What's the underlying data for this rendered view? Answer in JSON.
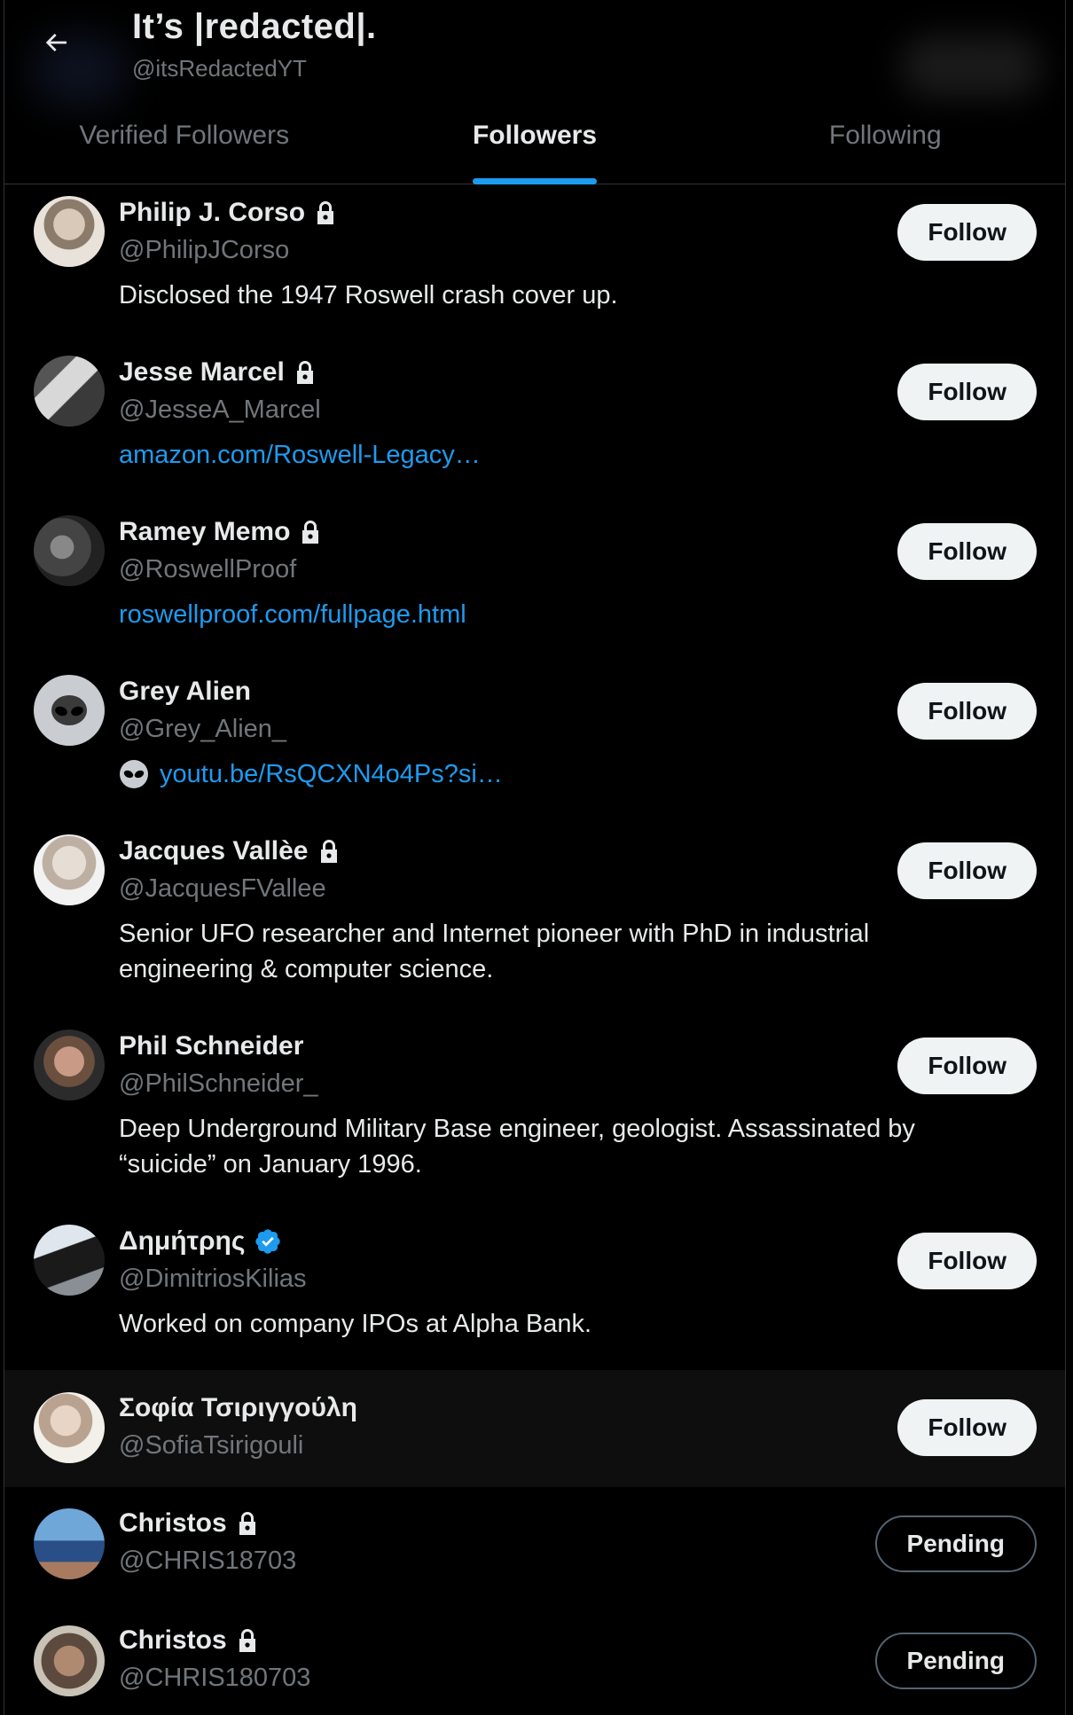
{
  "header": {
    "title": "It’s |redacted|.",
    "handle": "@itsRedactedYT"
  },
  "tabs": [
    {
      "label": "Verified Followers",
      "active": false
    },
    {
      "label": "Followers",
      "active": true
    },
    {
      "label": "Following",
      "active": false
    }
  ],
  "colors": {
    "accent": "#1d9bf0",
    "background": "#000000",
    "muted": "#71767b"
  },
  "users": [
    {
      "name": "Philip J. Corso",
      "handle": "@PhilipJCorso",
      "locked": true,
      "verified": false,
      "bio": "Disclosed the 1947 Roswell crash cover up.",
      "bio_is_link": false,
      "button": "Follow"
    },
    {
      "name": "Jesse Marcel",
      "handle": "@JesseA_Marcel",
      "locked": true,
      "verified": false,
      "bio": "amazon.com/Roswell-Legacy…",
      "bio_is_link": true,
      "button": "Follow"
    },
    {
      "name": "Ramey Memo",
      "handle": "@RoswellProof",
      "locked": true,
      "verified": false,
      "bio": "roswellproof.com/fullpage.html",
      "bio_is_link": true,
      "button": "Follow"
    },
    {
      "name": "Grey Alien",
      "handle": "@Grey_Alien_",
      "locked": false,
      "verified": false,
      "bio": "youtu.be/RsQCXN4o4Ps?si…",
      "bio_is_link": true,
      "bio_icon": "alien-emoji-icon",
      "button": "Follow"
    },
    {
      "name": "Jacques Vallèe",
      "handle": "@JacquesFVallee",
      "locked": true,
      "verified": false,
      "bio": "Senior UFO researcher and Internet pioneer with PhD in industrial engineering & computer science.",
      "bio_is_link": false,
      "button": "Follow"
    },
    {
      "name": "Phil Schneider",
      "handle": "@PhilSchneider_",
      "locked": false,
      "verified": false,
      "bio": "Deep Underground Military Base engineer, geologist. Assassinated by “suicide” on January 1996.",
      "bio_is_link": false,
      "button": "Follow"
    },
    {
      "name": "Δημήτρης",
      "handle": "@DimitriosKilias",
      "locked": false,
      "verified": true,
      "bio": "Worked on company IPOs at Alpha Bank.",
      "bio_is_link": false,
      "button": "Follow"
    },
    {
      "name": "Σοφία Τσιριγγούλη",
      "handle": "@SofiaTsirigouli",
      "locked": false,
      "verified": false,
      "bio": "",
      "bio_is_link": false,
      "button": "Follow"
    },
    {
      "name": "Christos",
      "handle": "@CHRIS18703",
      "locked": true,
      "verified": false,
      "bio": "",
      "bio_is_link": false,
      "button": "Pending"
    },
    {
      "name": "Christos",
      "handle": "@CHRIS180703",
      "locked": true,
      "verified": false,
      "bio": "",
      "bio_is_link": false,
      "button": "Pending"
    }
  ]
}
